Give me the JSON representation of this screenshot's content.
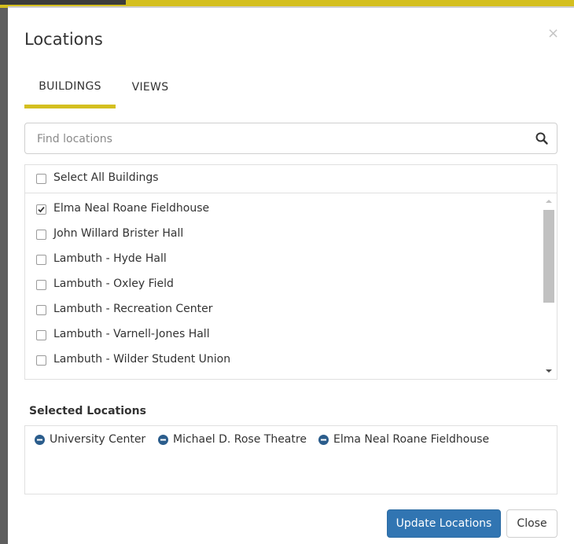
{
  "dialog": {
    "title": "Locations",
    "close_glyph": "×"
  },
  "tabs": [
    {
      "label": "BUILDINGS",
      "active": true
    },
    {
      "label": "VIEWS",
      "active": false
    }
  ],
  "search": {
    "placeholder": "Find locations",
    "value": "",
    "icon": "search-icon"
  },
  "select_all": {
    "label": "Select All Buildings",
    "checked": false
  },
  "buildings": [
    {
      "label": "Elma Neal Roane Fieldhouse",
      "checked": true
    },
    {
      "label": "John Willard Brister Hall",
      "checked": false
    },
    {
      "label": "Lambuth - Hyde Hall",
      "checked": false
    },
    {
      "label": "Lambuth - Oxley Field",
      "checked": false
    },
    {
      "label": "Lambuth - Recreation Center",
      "checked": false
    },
    {
      "label": "Lambuth - Varnell-Jones Hall",
      "checked": false
    },
    {
      "label": "Lambuth - Wilder Student Union",
      "checked": false
    }
  ],
  "selected": {
    "heading": "Selected Locations",
    "items": [
      {
        "label": "University Center",
        "icon": "minus-circle-icon"
      },
      {
        "label": "Michael D. Rose Theatre",
        "icon": "minus-circle-icon"
      },
      {
        "label": "Elma Neal Roane Fieldhouse",
        "icon": "minus-circle-icon"
      }
    ]
  },
  "buttons": {
    "update": "Update Locations",
    "close": "Close"
  },
  "colors": {
    "accent": "#d4bf1f",
    "primary_button": "#3175b2",
    "remove_icon": "#2b5d8c"
  }
}
